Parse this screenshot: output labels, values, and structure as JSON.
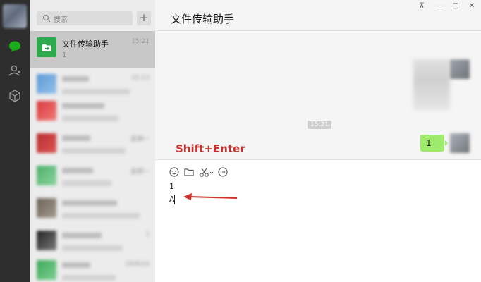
{
  "rail": {
    "icons": [
      "chat-icon",
      "contacts-icon",
      "cube-icon"
    ],
    "accent": "#1aad19"
  },
  "search": {
    "placeholder": "搜索",
    "add_label": "+"
  },
  "chat_list": {
    "active": {
      "name": "文件传输助手",
      "preview": "1",
      "time": "15:21"
    },
    "items": [
      {
        "time": "15:13"
      },
      {
        "time": ""
      },
      {
        "time": "星期一"
      },
      {
        "time": "星期一"
      },
      {
        "time": ""
      },
      {
        "time": "1"
      },
      {
        "time": "18/8/24"
      }
    ]
  },
  "main": {
    "title": "文件传输助手",
    "window_controls": [
      "⊼",
      "—",
      "□",
      "✕"
    ],
    "center_time": "15:21",
    "my_message": "1",
    "annotation": "Shift+Enter",
    "toolbar": [
      "emoji-icon",
      "folder-icon",
      "scissors-icon",
      "chat-bubble-icon"
    ],
    "input_lines": [
      "1",
      "A"
    ]
  },
  "colors": {
    "bubble": "#9eea6a",
    "annotation": "#c8312c",
    "rail": "#2e2e2e"
  }
}
